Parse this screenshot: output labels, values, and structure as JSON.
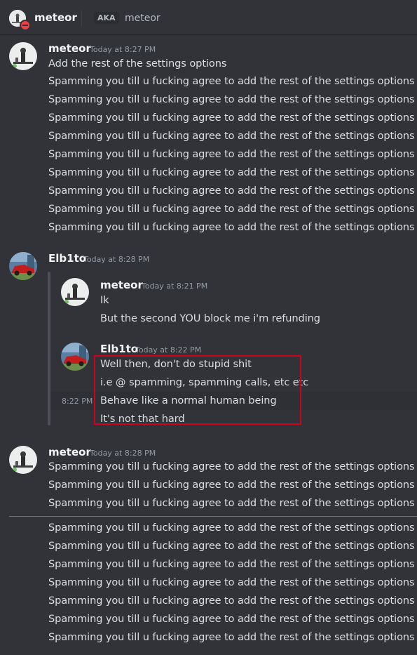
{
  "header": {
    "username": "meteor",
    "aka_label": "AKA",
    "aka_name": "meteor"
  },
  "messages": [
    {
      "author": "meteor",
      "timestamp": "Today at 8:27 PM",
      "lines": [
        "Add the rest of the settings options",
        "Spamming you till u fucking agree to add the rest of the settings options",
        "Spamming you till u fucking agree to add the rest of the settings options",
        "Spamming you till u fucking agree to add the rest of the settings options",
        "Spamming you till u fucking agree to add the rest of the settings options",
        "Spamming you till u fucking agree to add the rest of the settings options",
        "Spamming you till u fucking agree to add the rest of the settings options",
        "Spamming you till u fucking agree to add the rest of the settings options",
        "Spamming you till u fucking agree to add the rest of the settings options",
        "Spamming you till u fucking agree to add the rest of the settings options"
      ]
    },
    {
      "author": "Elb1to",
      "timestamp": "Today at 8:28 PM",
      "forwarded": [
        {
          "author": "meteor",
          "timestamp": "Today at 8:21 PM",
          "lines": [
            "Ik",
            "But the second YOU block me i'm refunding"
          ]
        },
        {
          "author": "Elb1to",
          "timestamp": "Today at 8:22 PM",
          "hover_time": "8:22 PM",
          "lines": [
            "Well then, don't do stupid shit",
            "i.e @ spamming, spamming calls, etc etc",
            "Behave like a normal human being",
            "It's not that hard"
          ]
        }
      ]
    },
    {
      "author": "meteor",
      "timestamp": "Today at 8:28 PM",
      "lines": [
        "Spamming you till u fucking agree to add the rest of the settings options",
        "Spamming you till u fucking agree to add the rest of the settings options",
        "Spamming you till u fucking agree to add the rest of the settings options",
        "Spamming you till u fucking agree to add the rest of the settings options",
        "Spamming you till u fucking agree to add the rest of the settings options",
        "Spamming you till u fucking agree to add the rest of the settings options",
        "Spamming you till u fucking agree to add the rest of the settings options",
        "Spamming you till u fucking agree to add the rest of the settings options",
        "Spamming you till u fucking agree to add the rest of the settings options",
        "Spamming you till u fucking agree to add the rest of the settings options"
      ]
    }
  ],
  "colors": {
    "background": "#313338",
    "highlight_border": "#d0021b",
    "new_messages_divider": "#f23f43",
    "status_dnd": "#f23f43"
  }
}
